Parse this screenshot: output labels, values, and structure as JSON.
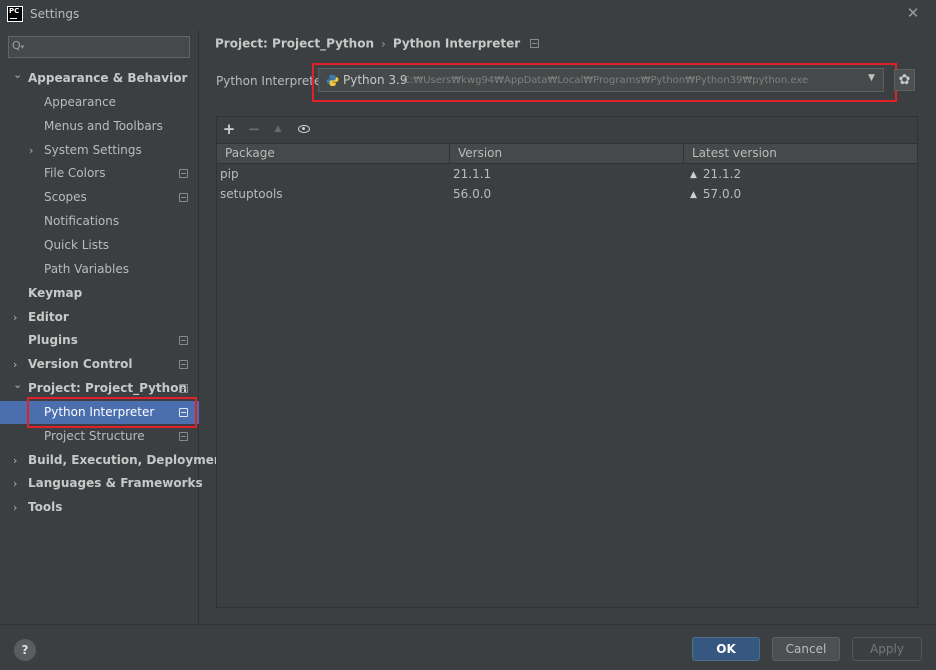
{
  "window": {
    "title": "Settings",
    "app_icon": "PC",
    "close_icon": "close-icon"
  },
  "sidebar": {
    "search": {
      "placeholder": "",
      "icon": "search-icon"
    },
    "items": [
      {
        "label": "Appearance & Behavior",
        "level": 0,
        "bold": true,
        "expanded": true
      },
      {
        "label": "Appearance",
        "level": 1
      },
      {
        "label": "Menus and Toolbars",
        "level": 1
      },
      {
        "label": "System Settings",
        "level": 1,
        "collapsed": true
      },
      {
        "label": "File Colors",
        "level": 1,
        "project_icon": true
      },
      {
        "label": "Scopes",
        "level": 1,
        "project_icon": true
      },
      {
        "label": "Notifications",
        "level": 1
      },
      {
        "label": "Quick Lists",
        "level": 1
      },
      {
        "label": "Path Variables",
        "level": 1
      },
      {
        "label": "Keymap",
        "level": 0,
        "bold": true
      },
      {
        "label": "Editor",
        "level": 0,
        "bold": true,
        "collapsed": true
      },
      {
        "label": "Plugins",
        "level": 0,
        "bold": true,
        "project_icon": true
      },
      {
        "label": "Version Control",
        "level": 0,
        "bold": true,
        "collapsed": true,
        "project_icon": true
      },
      {
        "label": "Project: Project_Python",
        "level": 0,
        "bold": true,
        "expanded": true,
        "project_icon": true
      },
      {
        "label": "Python Interpreter",
        "level": 1,
        "selected": true,
        "project_icon": true
      },
      {
        "label": "Project Structure",
        "level": 1,
        "project_icon": true
      },
      {
        "label": "Build, Execution, Deployment",
        "level": 0,
        "bold": true,
        "collapsed": true
      },
      {
        "label": "Languages & Frameworks",
        "level": 0,
        "bold": true,
        "collapsed": true
      },
      {
        "label": "Tools",
        "level": 0,
        "bold": true,
        "collapsed": true
      }
    ]
  },
  "breadcrumb": {
    "parent": "Project: Project_Python",
    "separator": "›",
    "current": "Python Interpreter"
  },
  "interpreter": {
    "label": "Python Interpreter:",
    "version": "Python 3.9",
    "path": "C:₩Users₩kwg94₩AppData₩Local₩Programs₩Python₩Python39₩python.exe",
    "dropdown_arrow": "▼",
    "settings_icon": "gear-icon"
  },
  "packages": {
    "toolbar": {
      "add": "+",
      "remove": "−",
      "upgrade": "▲",
      "show_early": "eye-icon"
    },
    "columns": [
      "Package",
      "Version",
      "Latest version"
    ],
    "rows": [
      {
        "name": "pip",
        "version": "21.1.1",
        "latest": "21.1.2",
        "upgrade_available": true
      },
      {
        "name": "setuptools",
        "version": "56.0.0",
        "latest": "57.0.0",
        "upgrade_available": true
      }
    ]
  },
  "footer": {
    "help": "?",
    "ok": "OK",
    "cancel": "Cancel",
    "apply": "Apply"
  },
  "colors": {
    "background": "#3c3f41",
    "selection": "#4b6eaf",
    "ok_button": "#365880",
    "highlight": "#e0202a"
  }
}
